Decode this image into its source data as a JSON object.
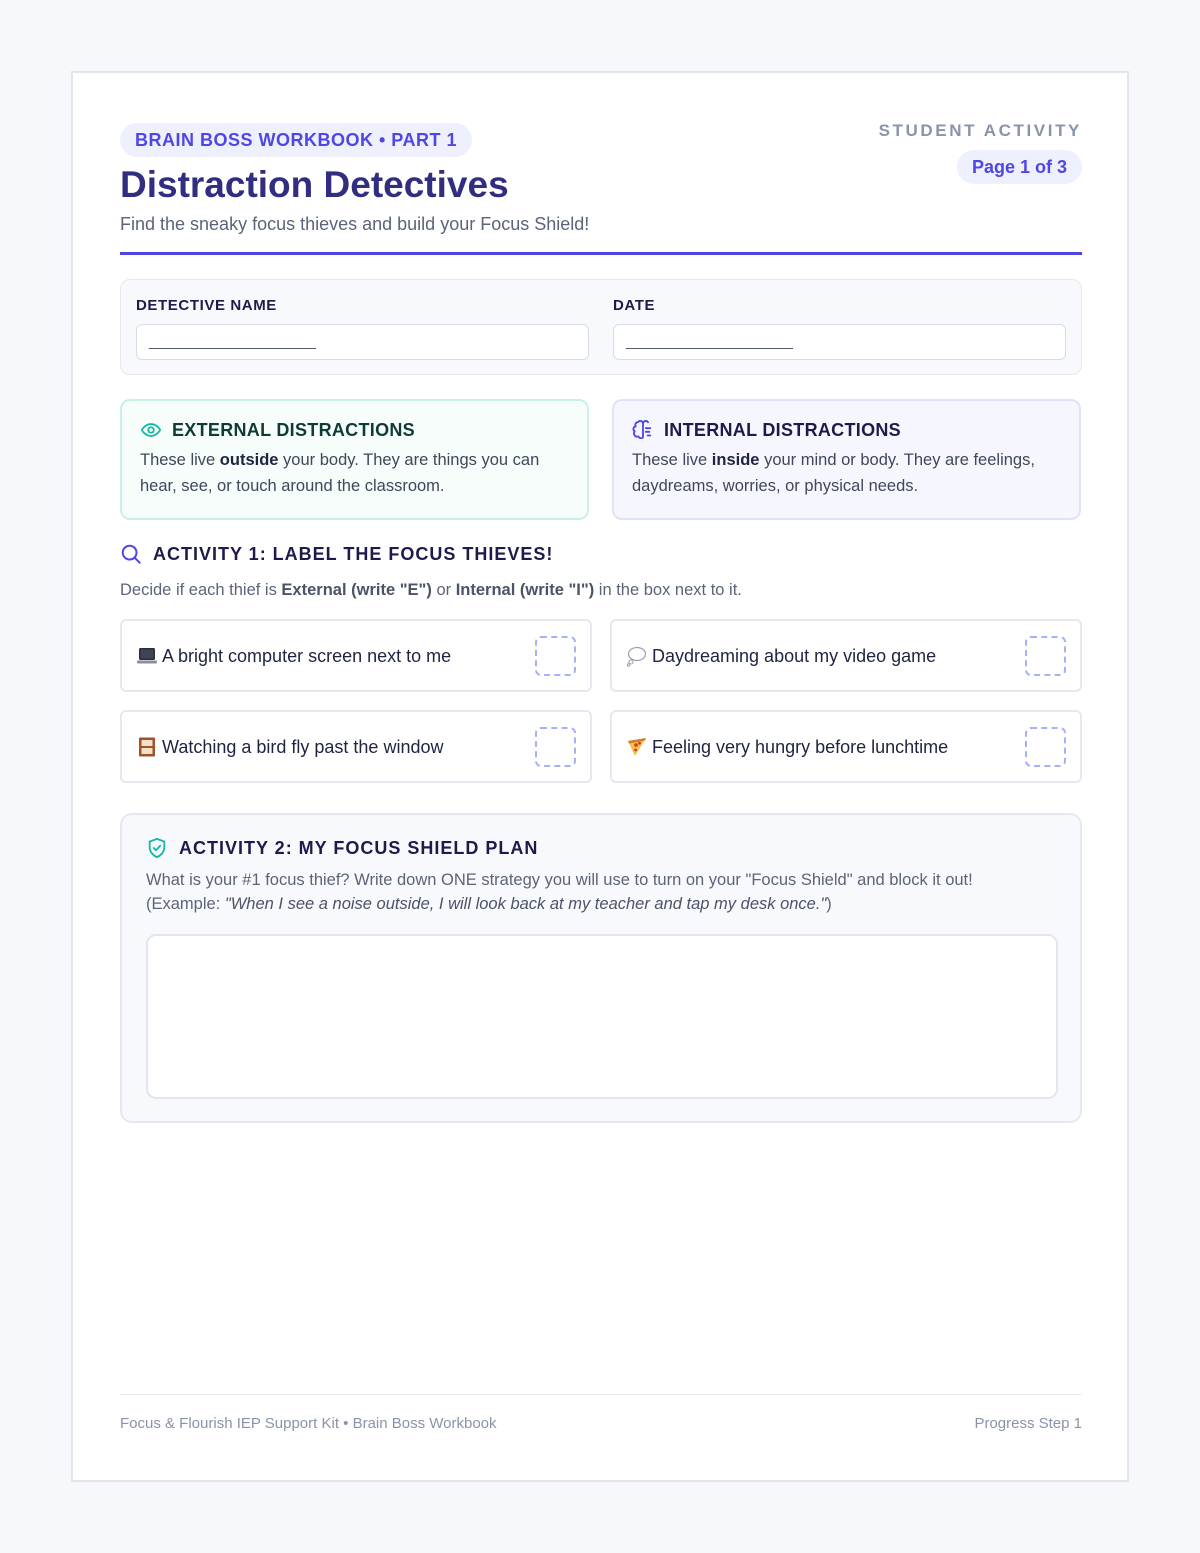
{
  "header": {
    "series": "BRAIN BOSS WORKBOOK • PART 1",
    "title": "Distraction Detectives",
    "subtitle": "Find the sneaky focus thieves and build your Focus Shield!",
    "label": "STUDENT ACTIVITY",
    "page": "Page 1 of 3"
  },
  "fields": {
    "name_label": "DETECTIVE NAME",
    "name_value": "____________________",
    "date_label": "DATE",
    "date_value": "____________________"
  },
  "info": {
    "external": {
      "title": "EXTERNAL DISTRACTIONS",
      "pre": "These live ",
      "bold": "outside",
      "post": " your body. They are things you can hear, see, or touch around the classroom.",
      "icon": "eye-icon",
      "color": "#14b8a6"
    },
    "internal": {
      "title": "INTERNAL DISTRACTIONS",
      "pre": "These live ",
      "bold": "inside",
      "post": " your mind or body. They are feelings, daydreams, worries, or physical needs.",
      "icon": "brain-icon",
      "color": "#4f46e5"
    }
  },
  "activity1": {
    "title": "ACTIVITY 1: LABEL THE FOCUS THIEVES!",
    "desc_pre": "Decide if each thief is ",
    "desc_ext": "External (write \"E\")",
    "desc_mid": " or ",
    "desc_int": "Internal (write \"I\")",
    "desc_post": " in the box next to it.",
    "items": [
      {
        "icon": "laptop-icon",
        "label": "A bright computer screen next to me"
      },
      {
        "icon": "thought-bubble-icon",
        "label": "Daydreaming about my video game"
      },
      {
        "icon": "window-icon",
        "label": "Watching a bird fly past the window"
      },
      {
        "icon": "pizza-icon",
        "label": "Feeling very hungry before lunchtime"
      }
    ]
  },
  "activity2": {
    "title": "ACTIVITY 2: MY FOCUS SHIELD PLAN",
    "line1": "What is your #1 focus thief? Write down ONE strategy you will use to turn on your \"Focus Shield\" and block it out!",
    "example_pre": "(Example: ",
    "example": "\"When I see a noise outside, I will look back at my teacher and tap my desk once.\"",
    "example_post": ")"
  },
  "footer": {
    "left": "Focus & Flourish IEP Support Kit • Brain Boss Workbook",
    "right": "Progress Step 1"
  },
  "colors": {
    "accent": "#4f46e5",
    "title": "#312e81",
    "teal": "#14b8a6"
  }
}
